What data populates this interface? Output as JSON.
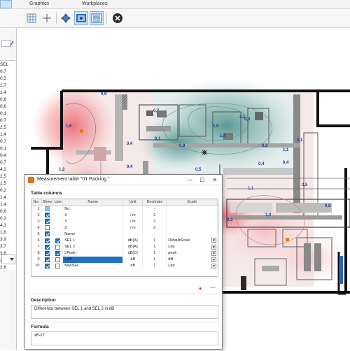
{
  "menu": {
    "items": [
      "Graphics",
      "Workplaces"
    ]
  },
  "toolbar": {
    "buttons": [
      "grid-icon",
      "crosshair-icon",
      "move-icon",
      "view-icon",
      "table-view-icon",
      "close-icon"
    ]
  },
  "left_panel": {
    "values": [
      "SEL",
      "0,7",
      "0,5",
      "1,7",
      "1,4",
      "0,8",
      "0,6",
      "0,1",
      "0,7",
      "2,5",
      "1,4",
      "0,7",
      "0,1",
      "0,4",
      "0,7",
      "4,2",
      "2,5",
      "1,5",
      "0,2",
      "1,4",
      "1,4",
      "0,6",
      "0,2",
      "4,3",
      "1,8",
      "3,9",
      "3,7",
      "3,6",
      "2,8",
      "2,6"
    ]
  },
  "plan": {
    "labels": [
      "0,9",
      "1,6",
      "0,7",
      "0,1",
      "1,6",
      "0,3",
      "2,1",
      "0,4",
      "0,8",
      "1,4",
      "0,2",
      "1,1",
      "0,5",
      "0,4",
      "0,1",
      "1,2",
      "0,4",
      "0,4",
      "2,2",
      "0,6",
      "1,1",
      "0,3",
      "1,0",
      "0,6",
      "0,5"
    ]
  },
  "dialog": {
    "title": "Measurement table \"01 Packing \"",
    "columns_label": "Table columns",
    "headers": [
      "No.",
      "Show",
      "Use",
      "Name",
      "Unit",
      "Decimals",
      "Scale"
    ],
    "rows": [
      {
        "no": "1",
        "show": "fixed",
        "use": "",
        "name": "No.",
        "unit": "",
        "decimals": "-",
        "scale": "",
        "dd": false
      },
      {
        "no": "2",
        "show": "on",
        "use": "",
        "name": "X",
        "unit": "/ m",
        "decimals": "2",
        "scale": "",
        "dd": false
      },
      {
        "no": "3",
        "show": "on",
        "use": "",
        "name": "Y",
        "unit": "/ m",
        "decimals": "2",
        "scale": "",
        "dd": false
      },
      {
        "no": "4",
        "show": "off",
        "use": "",
        "name": "Z",
        "unit": "/ m",
        "decimals": "2",
        "scale": "",
        "dd": false
      },
      {
        "no": "5",
        "show": "on",
        "use": "",
        "name": "Name",
        "unit": "",
        "decimals": "-",
        "scale": "",
        "dd": false
      },
      {
        "no": "6",
        "show": "on",
        "use": "on",
        "name": "SEL 1",
        "unit": "dB(A)",
        "decimals": "1",
        "scale": "DefaultScale",
        "dd": true
      },
      {
        "no": "7",
        "show": "on",
        "use": "off",
        "name": "SEL 2",
        "unit": "dB(A)",
        "decimals": "1",
        "scale": "Leq",
        "dd": true
      },
      {
        "no": "8",
        "show": "on",
        "use": "on",
        "name": "LPeak",
        "unit": "dB(C)",
        "decimals": "1",
        "scale": "peak",
        "dd": true
      },
      {
        "no": "9",
        "show": "on",
        "use": "off",
        "name": "Ldiff",
        "unit": "dB",
        "decimals": "1",
        "scale": "diff",
        "dd": true,
        "selected": true
      },
      {
        "no": "10",
        "show": "on",
        "use": "off",
        "name": "MaxSEL",
        "unit": "dB",
        "decimals": "1",
        "scale": "Leq",
        "dd": true
      }
    ],
    "description_label": "Description",
    "description_text": "Difference between SEL 1 and SEL 2 in dB",
    "formula_label": "Formula",
    "formula_text": "x6-x7"
  },
  "colors": {
    "accent": "#1f6fc4",
    "heat_red": "#ee6f78",
    "heat_teal": "#4f9492"
  }
}
